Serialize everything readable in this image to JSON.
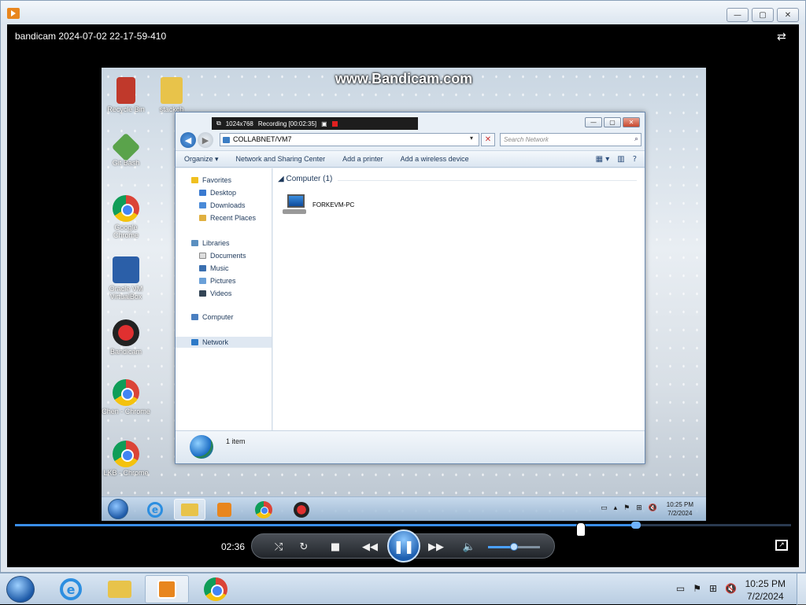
{
  "player": {
    "video_title": "bandicam 2024-07-02 22-17-59-410",
    "window_buttons": [
      "—",
      "▢",
      "✕"
    ],
    "elapsed_time": "02:36",
    "seek_progress": 0.8,
    "volume_level": 0.5,
    "controls": {
      "shuffle": "⤭",
      "repeat": "↻",
      "stop": "■",
      "previous": "◀◀",
      "play_pause": "❚❚",
      "next": "▶▶",
      "volume": "🔈"
    }
  },
  "video": {
    "watermark": "www.Bandicam.com",
    "desktop_icons": [
      {
        "label": "Recycle Bin",
        "icon": "recycle-bin-icon"
      },
      {
        "label": "stackch",
        "icon": "folder-icon"
      },
      {
        "label": "Git Bash",
        "icon": "git-bash-icon"
      },
      {
        "label": "Google Chrome",
        "icon": "chrome-icon"
      },
      {
        "label": "Oracle VM VirtualBox",
        "icon": "virtualbox-icon"
      },
      {
        "label": "Bandicam",
        "icon": "bandicam-icon"
      },
      {
        "label": "Chen - Chrome",
        "icon": "chrome-icon"
      },
      {
        "label": "LKB - Chrome",
        "icon": "chrome-icon"
      }
    ],
    "recorder_bar": {
      "resolution": "1024x768",
      "status": "Recording [00:02:35]"
    },
    "explorer": {
      "address": "COLLABNET/VM7",
      "search_placeholder": "Search Network",
      "toolbar": [
        "Organize ▾",
        "Network and Sharing Center",
        "Add a printer",
        "Add a wireless device"
      ],
      "nav": {
        "favorites": "Favorites",
        "favorites_items": [
          "Desktop",
          "Downloads",
          "Recent Places"
        ],
        "libraries": "Libraries",
        "libraries_items": [
          "Documents",
          "Music",
          "Pictures",
          "Videos"
        ],
        "computer": "Computer",
        "network": "Network"
      },
      "group_header": "Computer (1)",
      "items": [
        "FORKEVM-PC"
      ],
      "status": "1 item"
    },
    "taskbar": {
      "clock_time": "10:25 PM",
      "clock_date": "7/2/2024"
    }
  },
  "host_taskbar": {
    "clock_time": "10:25 PM",
    "clock_date": "7/2/2024"
  },
  "colors": {
    "accent": "#1e5fb0",
    "seek_fill": "#3a8ee8"
  }
}
